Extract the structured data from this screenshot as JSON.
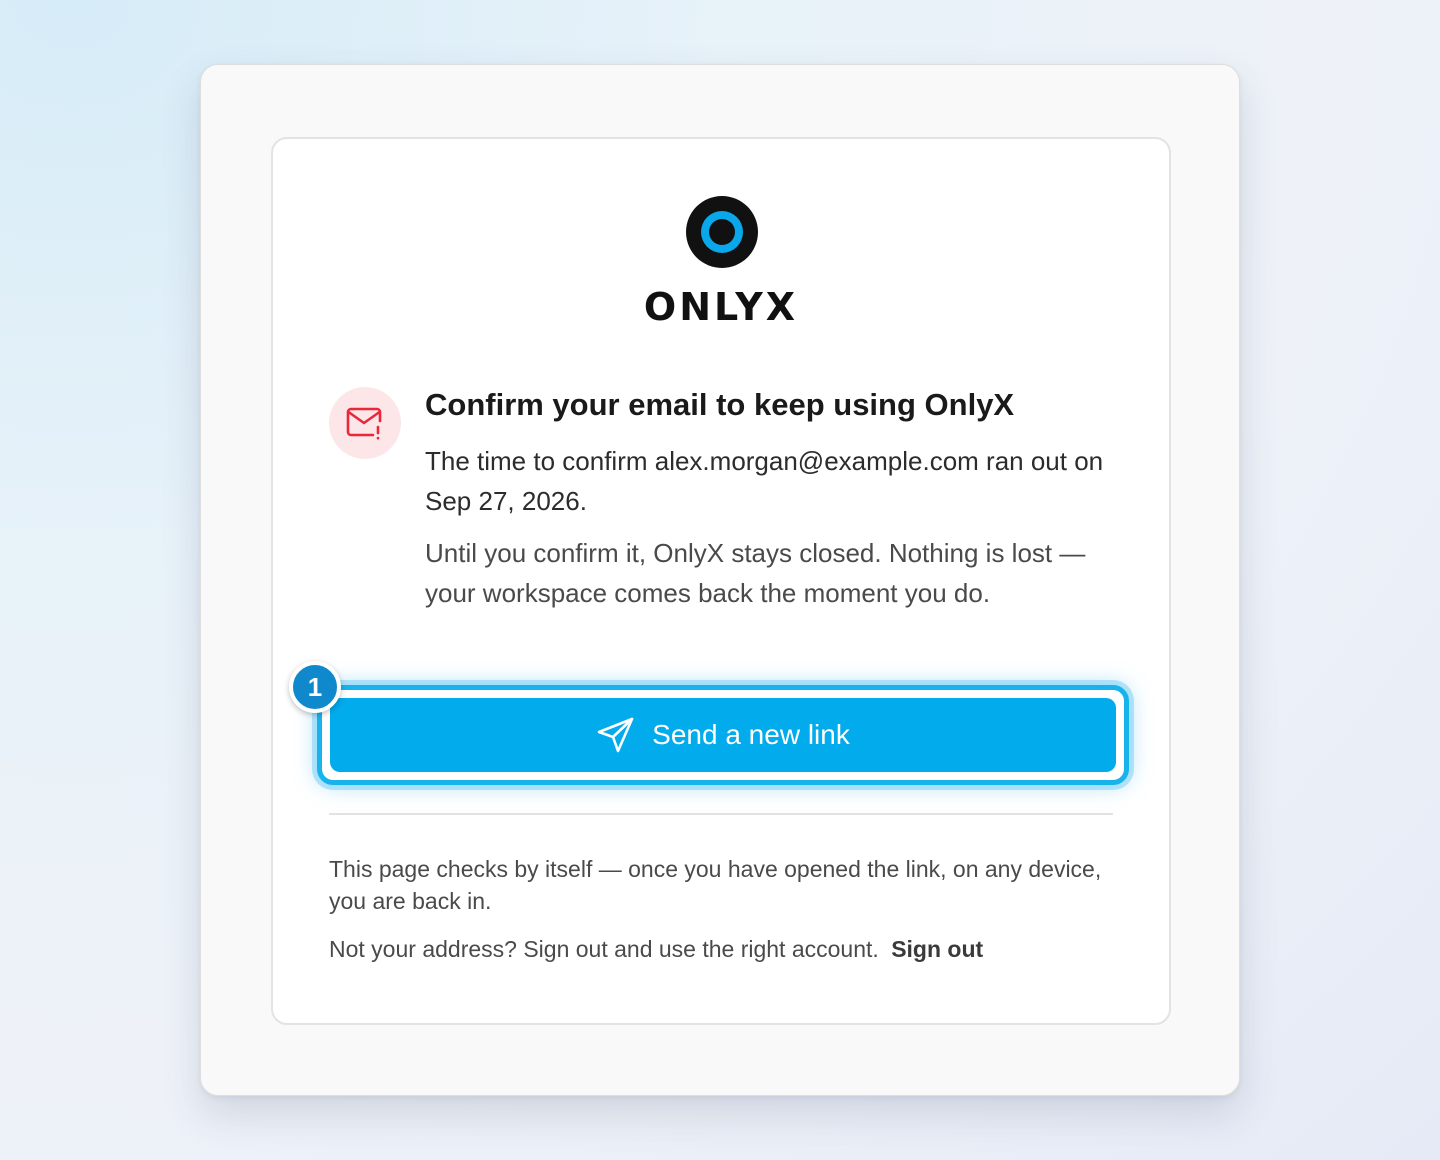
{
  "brand": {
    "name": "ONLYX",
    "accent_color": "#01abec"
  },
  "alert": {
    "icon": "mail-alert-icon",
    "title": "Confirm your email to keep using OnlyX",
    "message_1": "The time to confirm alex.morgan@example.com ran out on Sep 27, 2026.",
    "message_2": "Until you confirm it, OnlyX stays closed. Nothing is lost — your workspace comes back the moment you do."
  },
  "action": {
    "step_number": "1",
    "send_icon": "paper-plane-icon",
    "send_label": "Send a new link"
  },
  "footer": {
    "auto_check_text": "This page checks by itself — once you have opened the link, on any device, you are back in.",
    "wrong_address_text": "Not your address? Sign out and use the right account.",
    "sign_out_label": "Sign out"
  }
}
